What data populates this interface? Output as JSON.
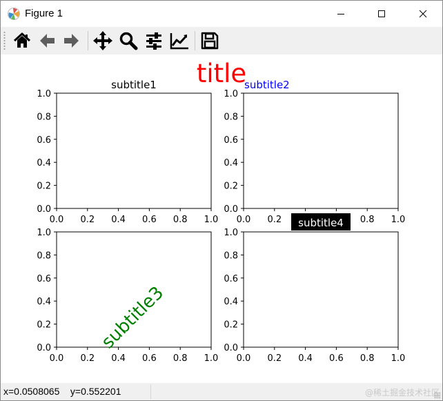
{
  "window": {
    "title": "Figure 1",
    "app_icon": "matplotlib-icon",
    "controls": [
      "minimize-icon",
      "maximize-icon",
      "close-icon"
    ]
  },
  "toolbar": {
    "buttons": [
      {
        "name": "home",
        "icon": "home-icon"
      },
      {
        "name": "back",
        "icon": "back-arrow-icon"
      },
      {
        "name": "forward",
        "icon": "forward-arrow-icon"
      },
      {
        "name": "pan",
        "icon": "pan-icon"
      },
      {
        "name": "zoom",
        "icon": "zoom-icon"
      },
      {
        "name": "configure-subplots",
        "icon": "sliders-icon"
      },
      {
        "name": "edit-axis",
        "icon": "line-chart-icon"
      },
      {
        "name": "save",
        "icon": "save-icon"
      }
    ]
  },
  "figure": {
    "suptitle": "title",
    "suptitle_color": "#ff0000",
    "axis_color": "#000000"
  },
  "chart_data": [
    {
      "type": "line",
      "title": "subtitle1",
      "title_color": "#000000",
      "series": [],
      "xlim": [
        0,
        1
      ],
      "ylim": [
        0,
        1
      ],
      "xticks": [
        "0.0",
        "0.2",
        "0.4",
        "0.6",
        "0.8",
        "1.0"
      ],
      "yticks": [
        "0.0",
        "0.2",
        "0.4",
        "0.6",
        "0.8",
        "1.0"
      ]
    },
    {
      "type": "line",
      "title": "subtitle2",
      "title_color": "#0000ff",
      "title_loc": "left",
      "series": [],
      "xlim": [
        0,
        1
      ],
      "ylim": [
        0,
        1
      ],
      "xticks": [
        "0.0",
        "0.2",
        "0.4",
        "0.6",
        "0.8",
        "1.0"
      ],
      "yticks": [
        "0.0",
        "0.2",
        "0.4",
        "0.6",
        "0.8",
        "1.0"
      ]
    },
    {
      "type": "line",
      "title": "subtitle3",
      "title_color": "#008000",
      "title_rotation": 45,
      "series": [],
      "xlim": [
        0,
        1
      ],
      "ylim": [
        0,
        1
      ],
      "xticks": [
        "0.0",
        "0.2",
        "0.4",
        "0.6",
        "0.8",
        "1.0"
      ],
      "yticks": [
        "0.0",
        "0.2",
        "0.4",
        "0.6",
        "0.8",
        "1.0"
      ]
    },
    {
      "type": "line",
      "title": "subtitle4",
      "title_color": "#ffffff",
      "title_background": "#000000",
      "series": [],
      "xlim": [
        0,
        1
      ],
      "ylim": [
        0,
        1
      ],
      "xticks": [
        "0.0",
        "0.2",
        "0.4",
        "0.6",
        "0.8",
        "1.0"
      ],
      "yticks": [
        "0.0",
        "0.2",
        "0.4",
        "0.6",
        "0.8",
        "1.0"
      ]
    }
  ],
  "statusbar": {
    "coords": "x=0.0508065    y=0.552201",
    "watermark": "@稀土掘金技术社区"
  }
}
